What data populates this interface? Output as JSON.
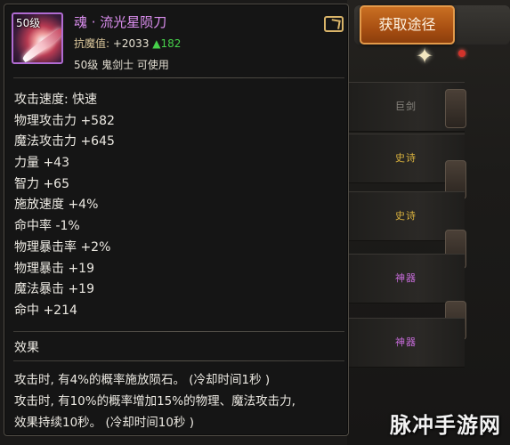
{
  "item": {
    "level_badge": "50级",
    "name": "魂 · 流光星陨刀",
    "score_label": "抗魔值: ",
    "score_value": "+2033",
    "score_up": "▲182",
    "requirement": "50级 鬼剑士 可使用"
  },
  "get_source_button": "获取途径",
  "stats": [
    "攻击速度: 快速",
    "物理攻击力 +582",
    "魔法攻击力 +645",
    "力量 +43",
    "智力 +65",
    "施放速度 +4%",
    "命中率 -1%",
    "物理暴击率 +2%",
    "物理暴击 +19",
    "魔法暴击 +19",
    "命中 +214"
  ],
  "effect": {
    "heading": "效果",
    "lines": [
      "攻击时, 有4%的概率施放陨石。 (冷却时间1秒 )",
      "攻击时, 有10%的概率增加15%的物理、魔法攻击力,",
      "效果持续10秒。 (冷却时间10秒 )"
    ]
  },
  "background_tags": [
    "巨剑",
    "史诗",
    "史诗",
    "神器",
    "神器"
  ],
  "watermark": "脉冲手游网",
  "colors": {
    "item_name": "#dc8ff0",
    "score_up": "#46d04a",
    "button": "#b85a18",
    "epic_tag": "#d9b23e",
    "artifact_tag": "#c56bd8"
  }
}
